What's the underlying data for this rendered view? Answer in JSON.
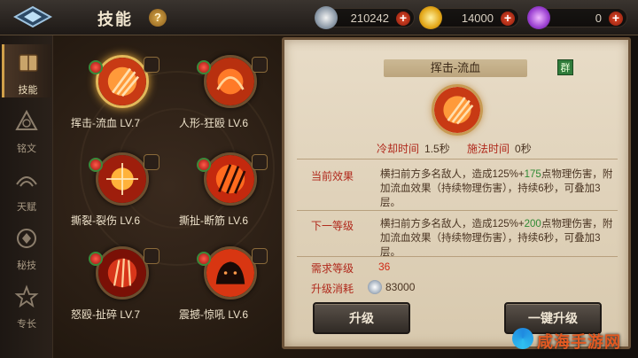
{
  "header": {
    "title": "技能",
    "help_label": "?",
    "resources": [
      {
        "icon": "silver-coin-icon",
        "value": "210242"
      },
      {
        "icon": "gold-coin-icon",
        "value": "14000"
      },
      {
        "icon": "purple-gem-icon",
        "value": "0"
      }
    ],
    "plus_label": "+"
  },
  "sidebar": {
    "items": [
      {
        "label": "技能",
        "icon": "skill-book-icon",
        "active": true
      },
      {
        "label": "铭文",
        "icon": "inscription-icon",
        "active": false
      },
      {
        "label": "天赋",
        "icon": "talent-icon",
        "active": false
      },
      {
        "label": "秘技",
        "icon": "secret-skill-icon",
        "active": false
      },
      {
        "label": "专长",
        "icon": "specialty-icon",
        "active": false
      }
    ]
  },
  "skills": [
    {
      "name": "挥击-流血 LV.7",
      "selected": true
    },
    {
      "name": "人形-狂殴 LV.6",
      "selected": false
    },
    {
      "name": "撕裂-裂伤 LV.6",
      "selected": false
    },
    {
      "name": "撕扯-断筋 LV.6",
      "selected": false
    },
    {
      "name": "怒殴-扯碎 LV.7",
      "selected": false
    },
    {
      "name": "震撼-惊吼 LV.6",
      "selected": false
    }
  ],
  "detail": {
    "title": "挥击-流血",
    "badge": "群",
    "cooldown_label": "冷却时间",
    "cooldown_value": "1.5秒",
    "cast_label": "施法时间",
    "cast_value": "0秒",
    "current_label": "当前效果",
    "current_text_a": "横扫前方多名敌人，造成125%+",
    "current_text_hl": "175",
    "current_text_b": "点物理伤害，附加流血效果（持续物理伤害），持续6秒，可叠加3层。",
    "next_label": "下一等级",
    "next_text_a": "横扫前方多名敌人，造成125%+",
    "next_text_hl": "200",
    "next_text_b": "点物理伤害，附加流血效果（持续物理伤害），持续6秒，可叠加3层。",
    "req_label": "需求等级",
    "req_value": "36",
    "cost_label": "升级消耗",
    "cost_value": "83000",
    "upgrade_button": "升级",
    "one_key_button": "一键升级"
  },
  "watermark": "咸海手游网",
  "colors": {
    "accent_gold": "#e2b85a",
    "red_text": "#b0291c",
    "green_text": "#2f8a34",
    "panel_bg": "#e8dcc7"
  }
}
